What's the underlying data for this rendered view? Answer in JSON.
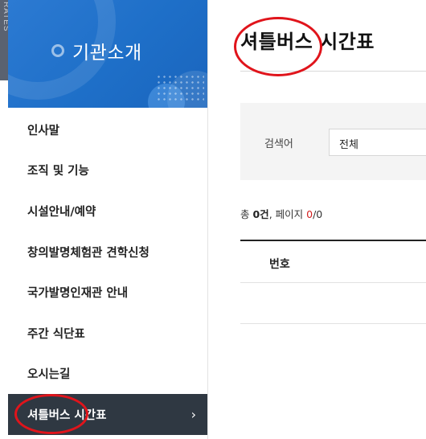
{
  "side_strip_text": "RATES",
  "sidebar": {
    "banner_title": "기관소개",
    "items": [
      {
        "label": "인사말"
      },
      {
        "label": "조직 및 기능"
      },
      {
        "label": "시설안내/예약"
      },
      {
        "label": "창의발명체험관 견학신청"
      },
      {
        "label": "국가발명인재관 안내"
      },
      {
        "label": "주간 식단표"
      },
      {
        "label": "오시는길"
      },
      {
        "label": "셔틀버스 시간표",
        "active": true,
        "chevron": "›"
      }
    ]
  },
  "main": {
    "page_title": "셔틀버스 시간표",
    "search": {
      "label": "검색어",
      "selected": "전체"
    },
    "summary": {
      "prefix": "총 ",
      "count": "0건",
      "sep": ", 페이지 ",
      "current_page": "0",
      "slash": "/",
      "total_pages": "0"
    },
    "table": {
      "headers": [
        "번호"
      ]
    }
  },
  "colors": {
    "banner": "#1e6fc8",
    "active_menu": "#2f3842",
    "annotation": "#e0141b",
    "accent_red": "#d21f1f"
  },
  "icons": [
    "ring-icon",
    "chevron-right-icon"
  ]
}
